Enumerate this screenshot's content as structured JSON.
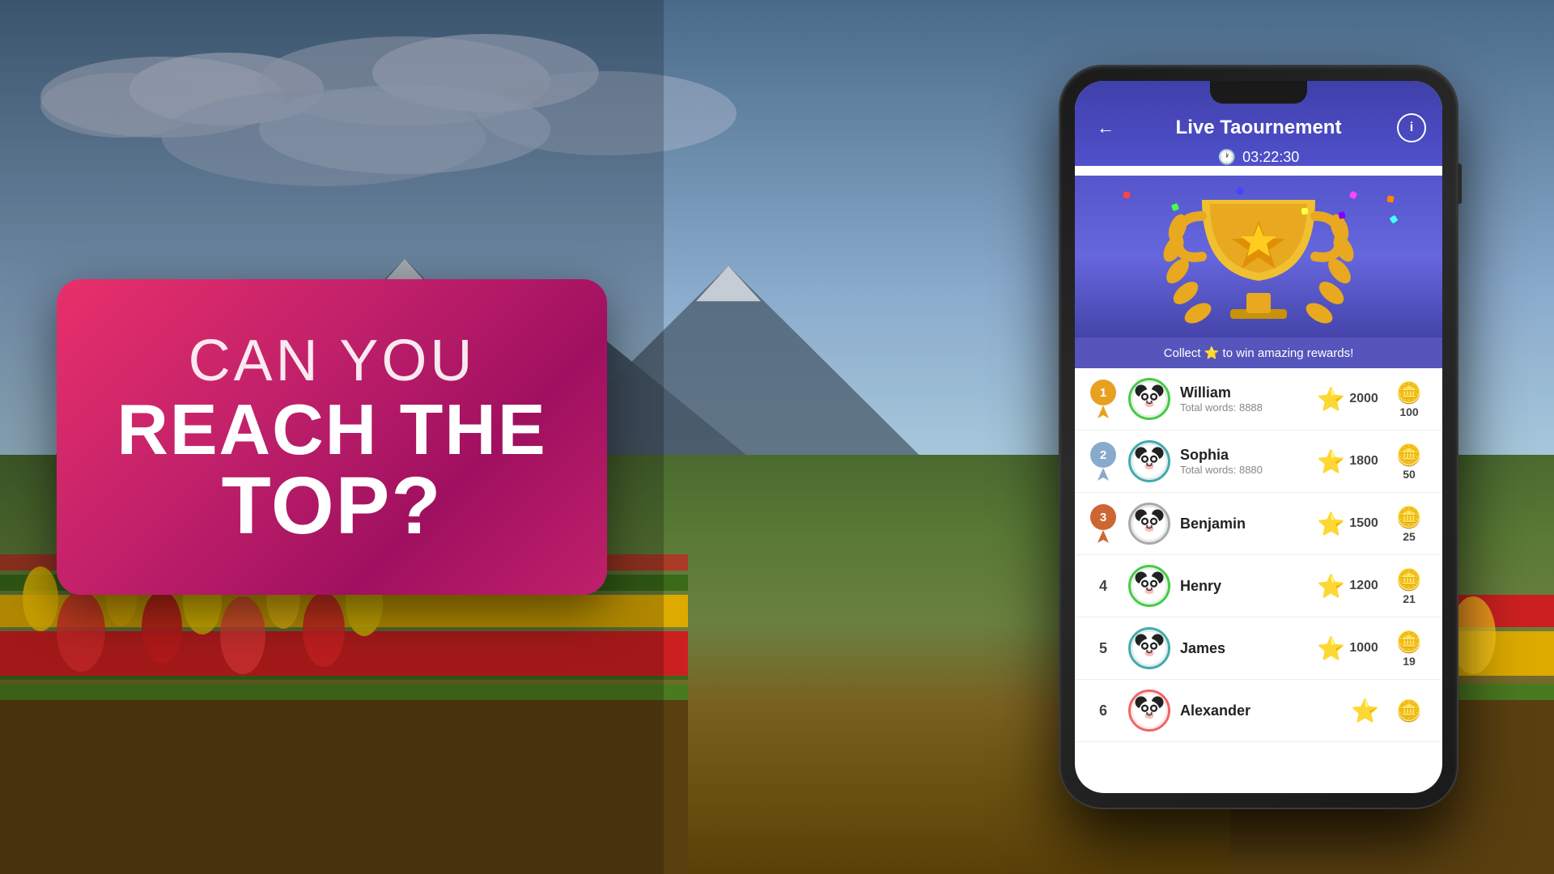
{
  "background": {
    "description": "Mountain landscape with tulip fields"
  },
  "promo": {
    "can_you": "CAN YOU",
    "reach_the": "REACH THE",
    "top": "TOP?"
  },
  "app": {
    "back_label": "←",
    "title": "Live Taournement",
    "info_label": "i",
    "timer": "03:22:30",
    "collect_text": "Collect ⭐ to win amazing rewards!",
    "leaderboard": [
      {
        "rank": 1,
        "name": "William",
        "words": "Total words: 8888",
        "score": 2000,
        "coins": 100,
        "avatar_color": "#228833",
        "border_class": "green-border"
      },
      {
        "rank": 2,
        "name": "Sophia",
        "words": "Total words: 8880",
        "score": 1800,
        "coins": 50,
        "avatar_color": "#1a6a8a",
        "border_class": "teal-border"
      },
      {
        "rank": 3,
        "name": "Benjamin",
        "words": "",
        "score": 1500,
        "coins": 25,
        "avatar_color": "#222222",
        "border_class": "gray-border"
      },
      {
        "rank": 4,
        "name": "Henry",
        "words": "",
        "score": 1200,
        "coins": 21,
        "avatar_color": "#228833",
        "border_class": "green-border"
      },
      {
        "rank": 5,
        "name": "James",
        "words": "",
        "score": 1000,
        "coins": 19,
        "avatar_color": "#1a6a8a",
        "border_class": "teal-border"
      },
      {
        "rank": 6,
        "name": "Alexander",
        "words": "",
        "score": "",
        "coins": "",
        "avatar_color": "#cc3333",
        "border_class": "pink-border"
      }
    ]
  }
}
